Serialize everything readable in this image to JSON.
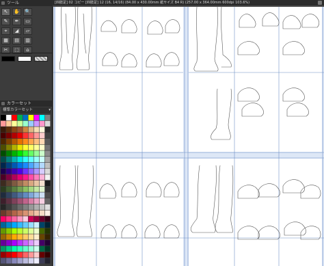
{
  "window": {
    "panel_title": "ツール",
    "document_title": "[四肢足] 02 コピー [四肢足] 12 (16, 14/16) (84.00 x 430.00mm 紙サイズ B4 R) (257.00 x 364.00mm 600dpi 103.6%)"
  },
  "tools": [
    [
      "↖",
      "✋",
      "🔍"
    ],
    [
      "✎",
      "✒",
      "▭"
    ],
    [
      "⌖",
      "◢",
      "▱"
    ],
    [
      "▦",
      "▤",
      "▥"
    ],
    [
      "✂",
      "⬚",
      "⌂"
    ]
  ],
  "colors": {
    "main_color": "#000000",
    "sub_color": "#ffffff",
    "accent": "#5a83c6"
  },
  "color_panel": {
    "title": "カラーセット",
    "set_name": "標準カラーセット"
  },
  "icons": {
    "panel_menu": "menu-icon",
    "close": "close-icon",
    "tools": [
      "move-icon",
      "hand-icon",
      "zoom-icon",
      "pen-icon",
      "brush-icon",
      "rect-select-icon",
      "eyedropper-icon",
      "fill-icon",
      "shape-icon",
      "grid-icon",
      "layer-icon",
      "ruler-icon",
      "cut-icon",
      "frame-icon",
      "home-icon"
    ]
  },
  "palette_colors": [
    "#000000",
    "#ffffff",
    "#ff0000",
    "#00b050",
    "#0070c0",
    "#ffff00",
    "#ff00ff",
    "#00ffff",
    "#7f7f7f",
    "#ff9999",
    "#ffcc99",
    "#ffff99",
    "#ccff99",
    "#99ffcc",
    "#99ccff",
    "#cc99ff",
    "#ff99cc",
    "#d9d9d9",
    "#3a1a0a",
    "#5c2e0a",
    "#8b4513",
    "#a0522d",
    "#cd853f",
    "#deb887",
    "#f5deb3",
    "#fff8dc",
    "#2b2b2b",
    "#4a0000",
    "#7a0000",
    "#b30000",
    "#e60000",
    "#ff3333",
    "#ff6666",
    "#ff9999",
    "#ffcccc",
    "#404040",
    "#4d2600",
    "#804000",
    "#b35900",
    "#e67300",
    "#ff8c1a",
    "#ffa64d",
    "#ffbf80",
    "#ffd9b3",
    "#595959",
    "#4d4d00",
    "#808000",
    "#b3b300",
    "#e6e600",
    "#ffff33",
    "#ffff66",
    "#ffff99",
    "#ffffcc",
    "#737373",
    "#004d00",
    "#008000",
    "#00b300",
    "#00e600",
    "#33ff33",
    "#66ff66",
    "#99ff99",
    "#ccffcc",
    "#8c8c8c",
    "#004d4d",
    "#008080",
    "#00b3b3",
    "#00e6e6",
    "#33ffff",
    "#66ffff",
    "#99ffff",
    "#ccffff",
    "#a6a6a6",
    "#00264d",
    "#004080",
    "#0059b3",
    "#0073e6",
    "#1a8cff",
    "#4da6ff",
    "#80bfff",
    "#b3d9ff",
    "#bfbfbf",
    "#1a004d",
    "#2e0080",
    "#4000b3",
    "#5200e6",
    "#7033ff",
    "#8f66ff",
    "#ad99ff",
    "#d6ccff",
    "#d9d9d9",
    "#4d0026",
    "#800040",
    "#b30059",
    "#e60073",
    "#ff1a8c",
    "#ff4da6",
    "#ff80bf",
    "#ffb3d9",
    "#f2f2f2",
    "#3d2b1f",
    "#5e4230",
    "#7f5a41",
    "#a07352",
    "#c18c63",
    "#d9a780",
    "#e8c4a3",
    "#f5e1cf",
    "#1a1a1a",
    "#2b3d1f",
    "#425e30",
    "#5a7f41",
    "#73a052",
    "#8cc163",
    "#a7d980",
    "#c4e8a3",
    "#e1f5cf",
    "#333333",
    "#1f2b3d",
    "#30425e",
    "#415a7f",
    "#5273a0",
    "#638cc1",
    "#80a7d9",
    "#a3c4e8",
    "#cfe1f5",
    "#4d4d4d",
    "#3d1f2b",
    "#5e3042",
    "#7f415a",
    "#a05273",
    "#c1638c",
    "#d980a7",
    "#e8a3c4",
    "#f5cfe1",
    "#666666",
    "#262626",
    "#3d3d3d",
    "#545454",
    "#6b6b6b",
    "#828282",
    "#999999",
    "#b0b0b0",
    "#c7c7c7",
    "#dedede",
    "#6b3a2a",
    "#8f4f39",
    "#b36548",
    "#c97b5c",
    "#d99373",
    "#e6ab8c",
    "#f0c4a8",
    "#f7dcc6",
    "#fff0e6",
    "#ff0066",
    "#ff3385",
    "#ff66a3",
    "#ff99c2",
    "#ffcce0",
    "#cc0052",
    "#990040",
    "#66002b",
    "#330015",
    "#006699",
    "#0088cc",
    "#00aaff",
    "#33bbff",
    "#66ccff",
    "#99ddff",
    "#ccefff",
    "#004466",
    "#002233",
    "#669900",
    "#88cc00",
    "#aaff00",
    "#bbff33",
    "#ccff66",
    "#ddff99",
    "#eeffcc",
    "#446600",
    "#223300",
    "#996600",
    "#cc8800",
    "#ffaa00",
    "#ffbb33",
    "#ffcc66",
    "#ffdd99",
    "#ffeecc",
    "#664400",
    "#332200",
    "#660099",
    "#8800cc",
    "#aa00ff",
    "#bb33ff",
    "#cc66ff",
    "#dd99ff",
    "#eeccff",
    "#440066",
    "#220033",
    "#009966",
    "#00cc88",
    "#00ffaa",
    "#33ffbb",
    "#66ffcc",
    "#99ffdd",
    "#ccffee",
    "#006644",
    "#003322",
    "#990000",
    "#cc0000",
    "#ff0000",
    "#ff3333",
    "#ff6666",
    "#ff9999",
    "#ffcccc",
    "#660000",
    "#330000",
    "#555577",
    "#6e6e99",
    "#8888bb",
    "#a2a2cc",
    "#bbbbdd",
    "#d5d5ee",
    "#eeeeff",
    "#3c3c55",
    "#22222e"
  ]
}
